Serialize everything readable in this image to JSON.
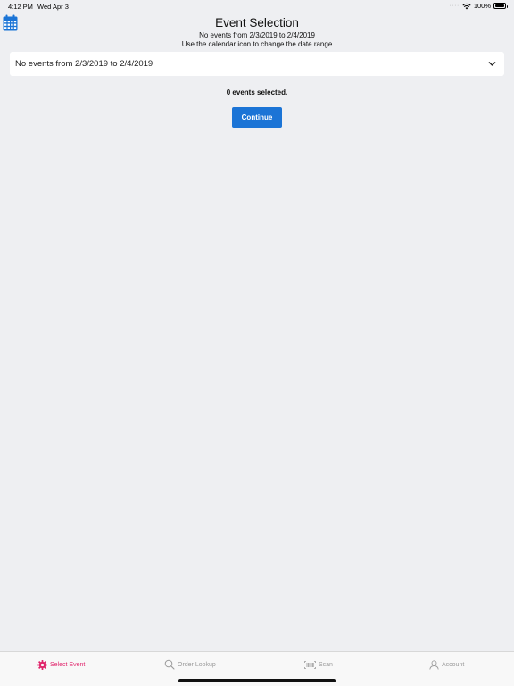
{
  "status_bar": {
    "time": "4:12 PM",
    "date": "Wed Apr 3",
    "battery": "100%",
    "icons": [
      "wifi-icon",
      "battery-icon"
    ]
  },
  "header": {
    "title": "Event Selection",
    "subtitle_line1": "No events from 2/3/2019 to 2/4/2019",
    "subtitle_line2": "Use the calendar icon to change the date range"
  },
  "calendar_button": {
    "icon": "calendar-icon"
  },
  "event_select": {
    "value": "No events from 2/3/2019 to 2/4/2019",
    "icon": "chevron-down-icon"
  },
  "selection": {
    "count_text": "0 events selected."
  },
  "continue_button": {
    "label": "Continue",
    "color": "#1b74d6"
  },
  "tab_bar": {
    "active_color": "#e0246b",
    "inactive_color": "#9a9a9a",
    "tabs": [
      {
        "label": "Select Event",
        "icon": "gear-icon",
        "active": true
      },
      {
        "label": "Order Lookup",
        "icon": "search-icon",
        "active": false
      },
      {
        "label": "Scan",
        "icon": "barcode-icon",
        "active": false
      },
      {
        "label": "Account",
        "icon": "person-icon",
        "active": false
      }
    ]
  }
}
